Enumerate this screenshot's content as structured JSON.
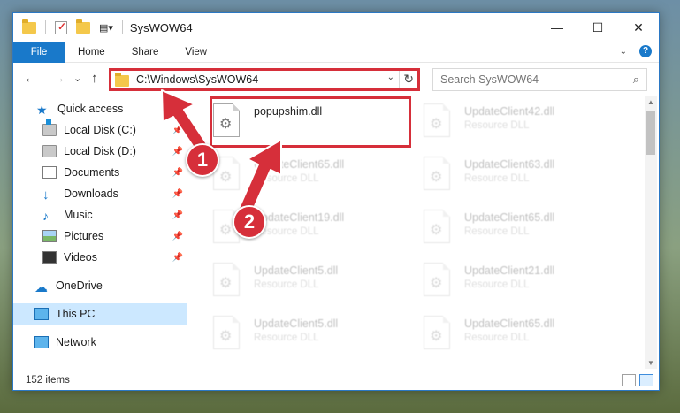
{
  "window": {
    "title": "SysWOW64"
  },
  "window_controls": {
    "minimize": "—",
    "maximize": "☐",
    "close": "✕"
  },
  "ribbon": {
    "tabs": [
      "File",
      "Home",
      "Share",
      "View"
    ],
    "help": "?"
  },
  "navigation": {
    "back": "←",
    "forward": "→",
    "recent": "⌄",
    "up": "↑",
    "address": "C:\\Windows\\SysWOW64",
    "refresh": "↻"
  },
  "search": {
    "placeholder": "Search SysWOW64"
  },
  "sidebar": {
    "items": [
      {
        "label": "Quick access",
        "icon": "star-icon",
        "pinned": false
      },
      {
        "label": "Local Disk (C:)",
        "icon": "drive-icon",
        "pinned": true
      },
      {
        "label": "Local Disk (D:)",
        "icon": "drive-icon",
        "pinned": true
      },
      {
        "label": "Documents",
        "icon": "documents-icon",
        "pinned": true
      },
      {
        "label": "Downloads",
        "icon": "downloads-icon",
        "pinned": true
      },
      {
        "label": "Music",
        "icon": "music-icon",
        "pinned": true
      },
      {
        "label": "Pictures",
        "icon": "pictures-icon",
        "pinned": true
      },
      {
        "label": "Videos",
        "icon": "videos-icon",
        "pinned": true
      },
      {
        "label": "OneDrive",
        "icon": "onedrive-icon",
        "pinned": false
      },
      {
        "label": "This PC",
        "icon": "this-pc-icon",
        "pinned": false,
        "selected": true
      },
      {
        "label": "Network",
        "icon": "network-icon",
        "pinned": false
      }
    ]
  },
  "files": [
    {
      "name": "popupshim.dll",
      "type": "",
      "highlighted": true
    },
    {
      "name": "UpdateClient42.dll",
      "type": "Resource DLL"
    },
    {
      "name": "UpdateClient65.dll",
      "type": "Resource DLL"
    },
    {
      "name": "UpdateClient63.dll",
      "type": "Resource DLL"
    },
    {
      "name": "UpdateClient19.dll",
      "type": "Resource DLL"
    },
    {
      "name": "UpdateClient65.dll",
      "type": "Resource DLL"
    },
    {
      "name": "UpdateClient5.dll",
      "type": "Resource DLL"
    },
    {
      "name": "UpdateClient21.dll",
      "type": "Resource DLL"
    },
    {
      "name": "UpdateClient5.dll",
      "type": "Resource DLL"
    },
    {
      "name": "UpdateClient65.dll",
      "type": "Resource DLL"
    }
  ],
  "status": {
    "item_count": "152 items"
  },
  "annotations": {
    "badge1": "1",
    "badge2": "2"
  },
  "colors": {
    "accent": "#1979ca",
    "highlight": "#d62f3a",
    "selected_bg": "#cce8ff"
  }
}
